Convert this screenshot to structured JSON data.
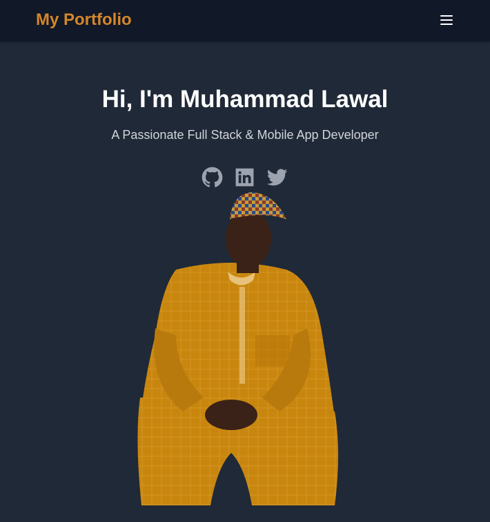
{
  "navbar": {
    "brand": "My Portfolio",
    "menu_icon": "hamburger-menu-icon"
  },
  "hero": {
    "title": "Hi, I'm Muhammad Lawal",
    "subtitle": "A Passionate Full Stack & Mobile App Developer",
    "socials": [
      {
        "icon": "github-icon"
      },
      {
        "icon": "linkedin-icon"
      },
      {
        "icon": "twitter-icon"
      }
    ]
  },
  "colors": {
    "background": "#1f2937",
    "navbar": "#111827",
    "brand": "#d4862a",
    "icon": "#9ca3af",
    "subtitle": "#d1d5db"
  }
}
